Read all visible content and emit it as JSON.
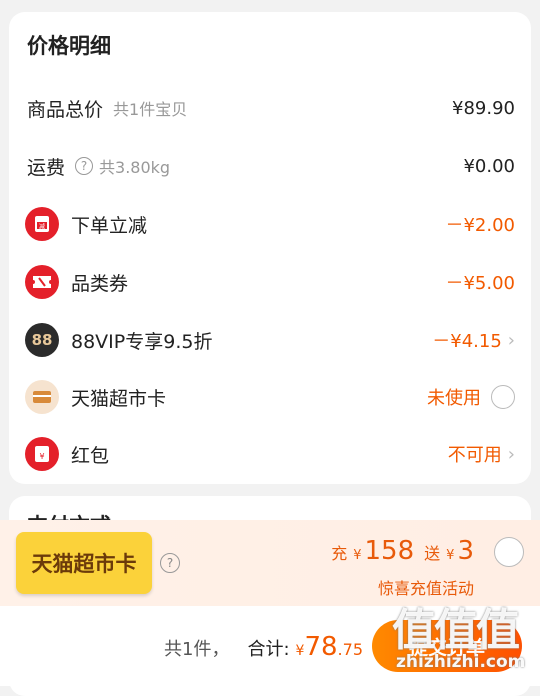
{
  "price_detail": {
    "title": "价格明细",
    "goods_total": {
      "label": "商品总价",
      "sub": "共1件宝贝",
      "amount": "¥89.90"
    },
    "shipping": {
      "label": "运费",
      "sub": "共3.80kg",
      "amount": "¥0.00",
      "icon": "question-circle-icon"
    },
    "discounts": [
      {
        "label": "下单立减",
        "amount": "－¥2.00",
        "icon": "red-envelope-icon"
      },
      {
        "label": "品类券",
        "amount": "－¥5.00",
        "icon": "ticket-icon"
      },
      {
        "label": "88VIP专享9.5折",
        "amount": "－¥4.15",
        "icon": "88vip-icon",
        "icon_text": "88"
      }
    ],
    "tmall_card": {
      "label": "天猫超市卡",
      "status": "未使用",
      "icon": "card-icon"
    },
    "red_packet": {
      "label": "红包",
      "status": "不可用",
      "icon": "red-packet-icon"
    }
  },
  "payment_section": {
    "title_partial": "支付方式"
  },
  "promo": {
    "badge": "天猫超市卡",
    "recharge_label": "充",
    "currency": "¥",
    "recharge_amount": "158",
    "bonus_label": "送",
    "bonus_amount": "3",
    "event": "惊喜充值活动"
  },
  "footer": {
    "count": "共1件，",
    "total_label": "合计:",
    "currency": "¥",
    "total_int": "78",
    "total_dec": ".75",
    "submit": "提交订单"
  },
  "watermark": {
    "big": "值值值",
    "small": "zhizhizhi.com"
  },
  "colors": {
    "accent": "#f25a00",
    "promo_badge": "#fbd23a",
    "icon_red": "#e4202a",
    "vip_dark": "#2b2b2b"
  }
}
